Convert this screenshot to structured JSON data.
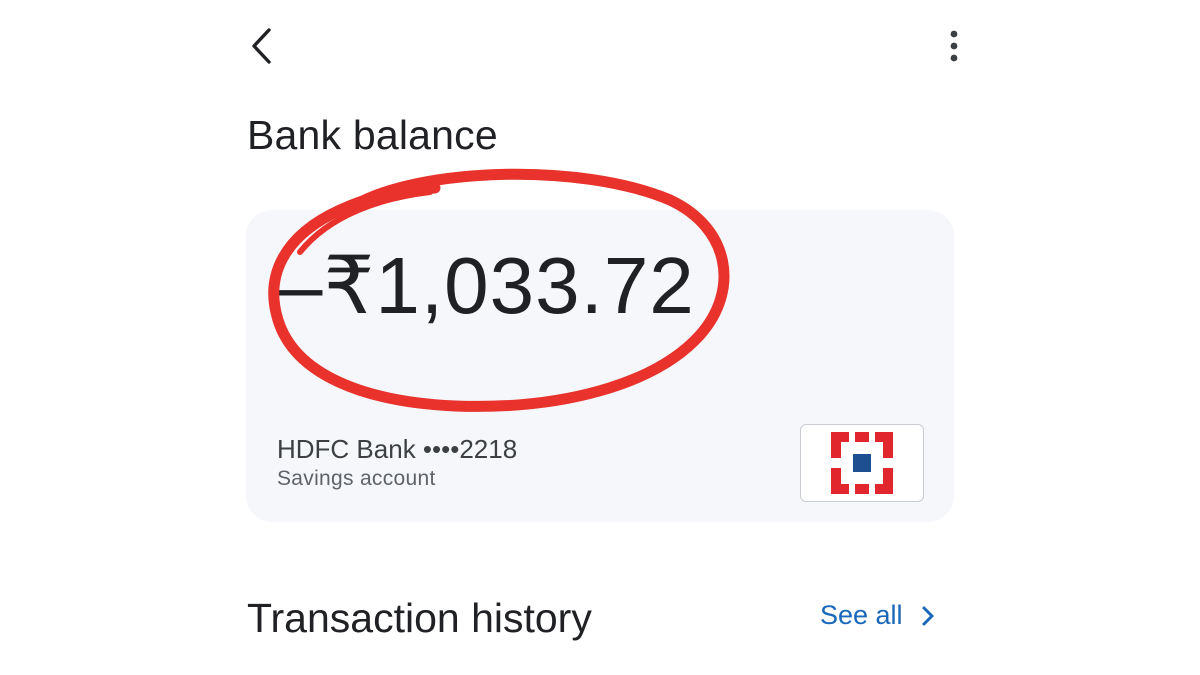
{
  "header": {
    "back_icon": "chevron-left-icon",
    "more_icon": "more-vertical-icon"
  },
  "page_title": "Bank balance",
  "balance": {
    "amount": "–₹1,033.72",
    "highlight_color": "#e8322b"
  },
  "account": {
    "bank_name": "HDFC Bank ••••2218",
    "type": "Savings account",
    "logo_icon": "hdfc-bank-logo",
    "logo_colors": {
      "red": "#e1262d",
      "blue": "#1d4f91"
    }
  },
  "transactions": {
    "title": "Transaction history",
    "see_all_label": "See all",
    "see_all_icon": "chevron-right-icon"
  }
}
